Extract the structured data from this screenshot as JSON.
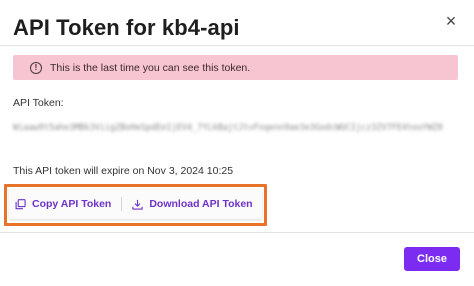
{
  "dialog": {
    "title": "API Token for kb4-api",
    "close_symbol": "×"
  },
  "alert": {
    "icon": "info-icon",
    "icon_glyph": "!",
    "message": "This is the last time you can see this token.",
    "background_color": "#f7c4d1"
  },
  "token": {
    "label": "API Token:",
    "value_blurred": "Wiaaw9t5ahe3MBk3ViigZBoHeSpdEeIjEV4_7YLkBajtJtvFnqenn9ae3e3GodcWUCIjcz3ZV7FE4teoYWZ0"
  },
  "expiry": {
    "text": "This API token will expire on Nov 3, 2024 10:25"
  },
  "actions": {
    "copy_label": "Copy API Token",
    "copy_icon": "copy-icon",
    "download_label": "Download API Token",
    "download_icon": "download-icon",
    "accent_color": "#6d32c9",
    "highlight_color": "#e8732a"
  },
  "footer": {
    "close_label": "Close",
    "close_color": "#7b2cf0"
  }
}
